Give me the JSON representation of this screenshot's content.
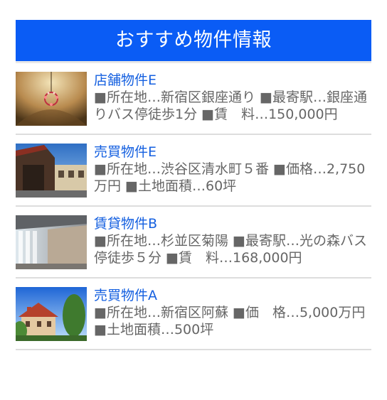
{
  "header": {
    "title": "おすすめ物件情報"
  },
  "items": [
    {
      "title": "店舗物件E",
      "desc": "■所在地…新宿区銀座通り ■最寄駅…銀座通りバス停徒歩1分 ■賃　料…150,000円",
      "image_icon": "chandelier-interior-photo"
    },
    {
      "title": "売買物件E",
      "desc": "■所在地…渋谷区清水町５番 ■価格…2,750万円 ■土地面積…60坪",
      "image_icon": "building-exterior-photo"
    },
    {
      "title": "賃貸物件B",
      "desc": "■所在地…杉並区菊陽 ■最寄駅…光の森バス停徒歩５分 ■賃　料…168,000円",
      "image_icon": "lobby-interior-photo"
    },
    {
      "title": "売買物件A",
      "desc": "■所在地…新宿区阿蘇 ■価　格…5,000万円 ■土地面積…500坪",
      "image_icon": "house-with-trees-photo"
    }
  ],
  "colors": {
    "header_bg": "#0a5cf5",
    "link": "#1560e0",
    "text": "#666666",
    "divider": "#dddddd"
  }
}
